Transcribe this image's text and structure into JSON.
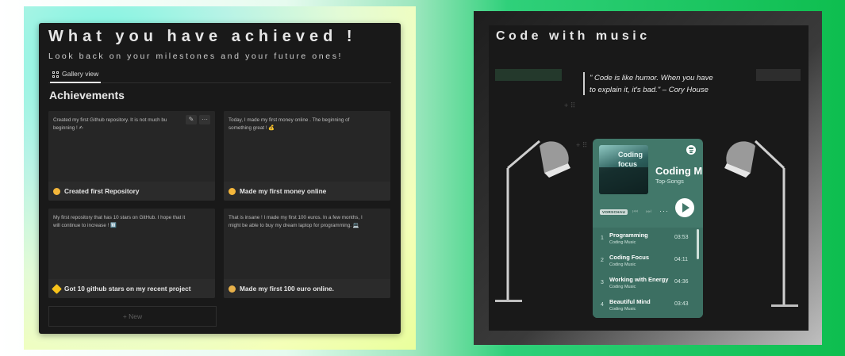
{
  "left": {
    "title": "What you have achieved !",
    "subtitle": "Look back on your milestones and your future ones!",
    "tab_label": "Gallery view",
    "section_title": "Achievements",
    "cards": [
      {
        "text": "Created my first Github repository. It is not much bu",
        "text2": "beginning ! ✍",
        "label": "Created first Repository",
        "emoji_color": "#f3b63a"
      },
      {
        "text": "Today, I made my first money online . The beginning of",
        "text2": "something great ! 💰",
        "label": "Made my first money online",
        "emoji_color": "#f5b73b"
      },
      {
        "text": "My first repository that has 10 stars on GitHub. I hope that it",
        "text2": "will continue to increase ! 🔟",
        "label": "Got 10 github stars on my recent project",
        "emoji_color": "#f7c21a"
      },
      {
        "text": "That is insane ! I made my first 100 euros. In a few months, I",
        "text2": "might be able to buy my dream laptop for programming. 💻",
        "label": "Made my first 100 euro online.",
        "emoji_color": "#e8b14a"
      }
    ],
    "new_button": "+ New",
    "card_actions": [
      "✎",
      "···"
    ]
  },
  "right": {
    "title": "Code with music",
    "quote_line1": "\" Code is like humor. When you have",
    "quote_line2": "to explain it, it's bad.\" – Cory House",
    "player": {
      "cover_text1": "Coding",
      "cover_text2": "focus",
      "title": "Coding M",
      "subtitle": "Top-Songs",
      "badge": "VORSCHAU",
      "more": "···",
      "tracks": [
        {
          "num": "1",
          "name": "Programming",
          "artist": "Coding Music",
          "duration": "03:53"
        },
        {
          "num": "2",
          "name": "Coding Focus",
          "artist": "Coding Music",
          "duration": "04:11"
        },
        {
          "num": "3",
          "name": "Working with Energy",
          "artist": "Coding Music",
          "duration": "04:36"
        },
        {
          "num": "4",
          "name": "Beautiful Mind",
          "artist": "Coding Music",
          "duration": "03:43"
        }
      ]
    }
  }
}
